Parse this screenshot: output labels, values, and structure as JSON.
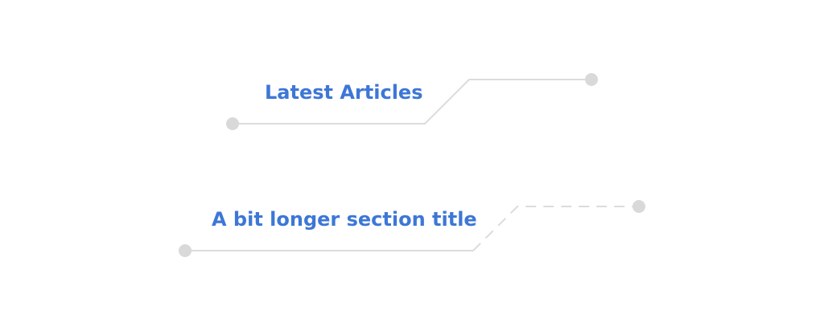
{
  "colors": {
    "title": "#3d77d6",
    "line": "#dcdcdc",
    "dot": "#d9d9d9"
  },
  "sections": [
    {
      "title": "Latest Articles",
      "line_style": "solid"
    },
    {
      "title": "A bit longer section title",
      "line_style": "solid-then-dashed"
    }
  ]
}
